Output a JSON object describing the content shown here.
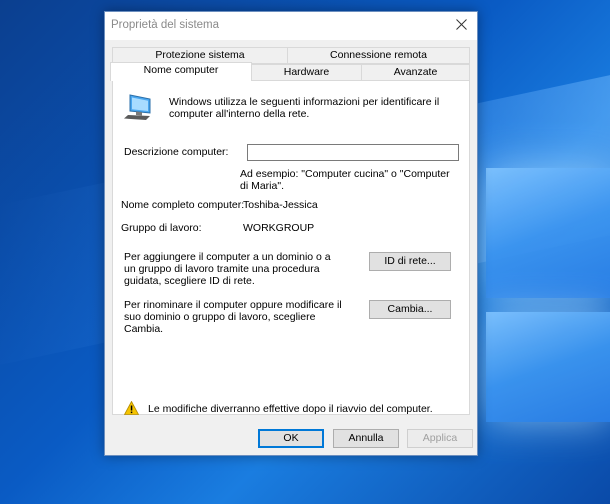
{
  "dialog": {
    "title": "Proprietà del sistema"
  },
  "tabs": {
    "row1": [
      "Protezione sistema",
      "Connessione remota"
    ],
    "row2": [
      "Nome computer",
      "Hardware",
      "Avanzate"
    ]
  },
  "content": {
    "intro": "Windows utilizza le seguenti informazioni per identificare il computer all'interno della rete.",
    "description_label": "Descrizione computer:",
    "description_value": "",
    "example": "Ad esempio: \"Computer cucina\" o \"Computer di Maria\".",
    "full_name_label": "Nome completo computer:",
    "full_name_value": "Toshiba-Jessica",
    "workgroup_label": "Gruppo di lavoro:",
    "workgroup_value": "WORKGROUP",
    "network_id_text": "Per aggiungere il computer a un dominio o a un gruppo di lavoro tramite una procedura guidata, scegliere ID di rete.",
    "network_id_button": "ID di rete...",
    "rename_text": "Per rinominare il computer oppure modificare il suo dominio o gruppo di lavoro, scegliere Cambia.",
    "change_button": "Cambia...",
    "warning": "Le modifiche diverranno effettive dopo il riavvio del computer."
  },
  "footer": {
    "ok": "OK",
    "cancel": "Annulla",
    "apply": "Applica"
  },
  "icons": {
    "computer": "computer-icon",
    "warning": "warning-icon",
    "close": "close-icon"
  },
  "colors": {
    "accent": "#0078d7",
    "desktop": "#0a5bc4"
  }
}
